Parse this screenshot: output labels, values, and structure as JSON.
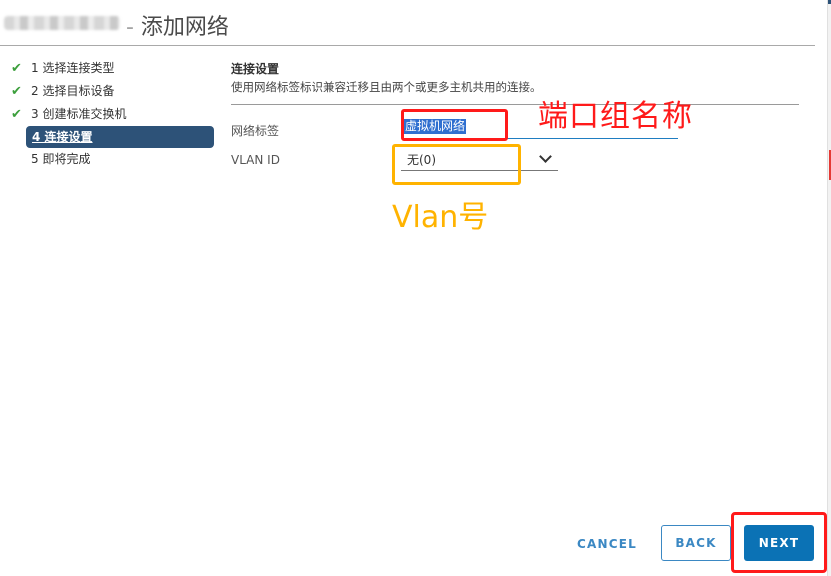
{
  "header": {
    "title": "- 添加网络"
  },
  "steps": [
    {
      "number": "1",
      "label": "选择连接类型",
      "state": "done"
    },
    {
      "number": "2",
      "label": "选择目标设备",
      "state": "done"
    },
    {
      "number": "3",
      "label": "创建标准交换机",
      "state": "done"
    },
    {
      "number": "4",
      "label": "连接设置",
      "state": "active"
    },
    {
      "number": "5",
      "label": "即将完成",
      "state": "pending"
    }
  ],
  "step_texts": {
    "s1": "1 选择连接类型",
    "s2": "2 选择目标设备",
    "s3": "3 创建标准交换机",
    "s4": "4 连接设置",
    "s5": "5 即将完成"
  },
  "icons": {
    "check": "✔"
  },
  "content": {
    "section_title": "连接设置",
    "section_desc": "使用网络标签标识兼容迁移且由两个或更多主机共用的连接。",
    "network_label_label": "网络标签",
    "network_label_value": "虚拟机网络",
    "vlan_label": "VLAN ID",
    "vlan_value": "无(0)"
  },
  "annotations": {
    "port_group_name": "端口组名称",
    "vlan_number": "Vlan号",
    "red": "#ff1a1a",
    "yellow": "#ffb300"
  },
  "buttons": {
    "cancel": "CANCEL",
    "back": "BACK",
    "next": "NEXT"
  },
  "colors": {
    "accent": "#0b72b5",
    "active_step": "#2d5278",
    "check": "#3c9f3c"
  }
}
